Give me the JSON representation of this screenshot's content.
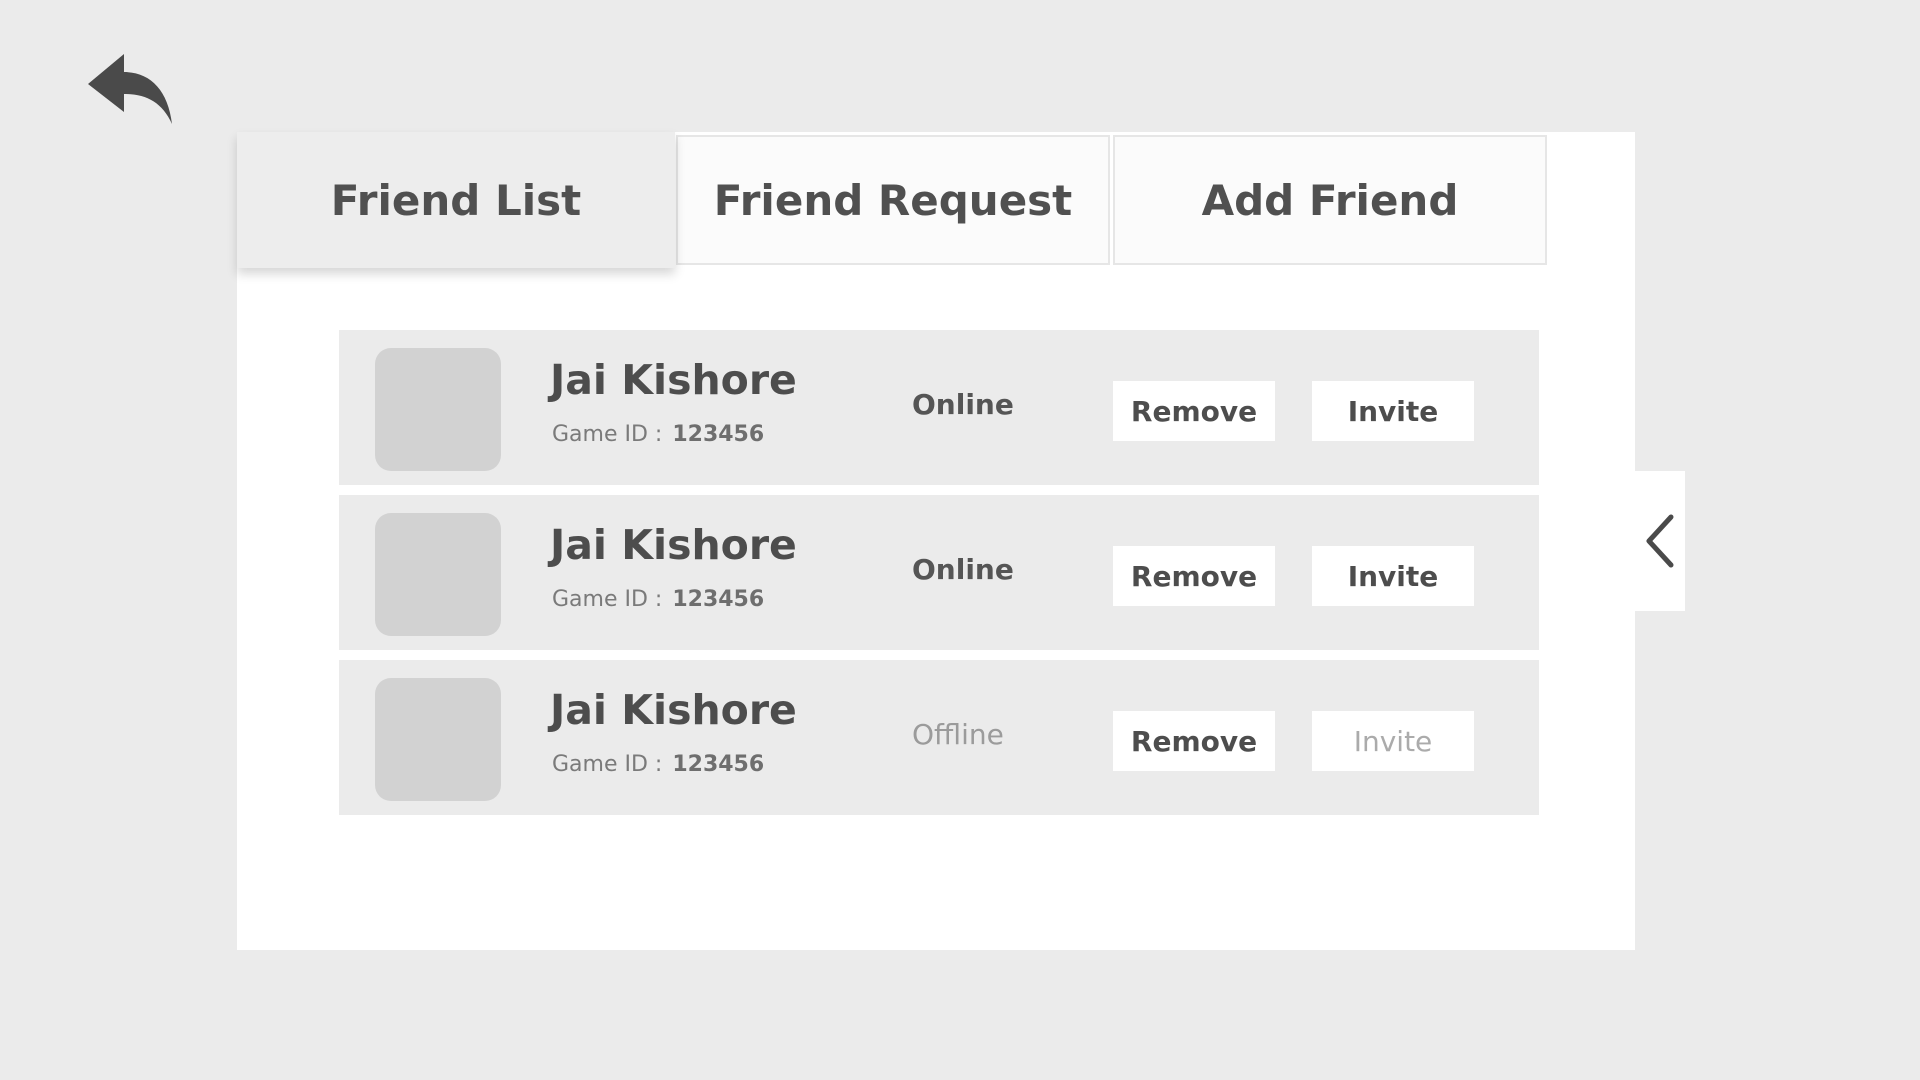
{
  "nav": {
    "back_icon": "back-arrow-icon"
  },
  "tabs": [
    {
      "label": "Friend List",
      "active": true
    },
    {
      "label": "Friend Request",
      "active": false
    },
    {
      "label": "Add Friend",
      "active": false
    }
  ],
  "friends": [
    {
      "name": "Jai Kishore",
      "game_id_label": "Game ID :",
      "game_id": "123456",
      "status": "Online",
      "remove_label": "Remove",
      "invite_label": "Invite",
      "invite_enabled": true
    },
    {
      "name": "Jai Kishore",
      "game_id_label": "Game ID :",
      "game_id": "123456",
      "status": "Online",
      "remove_label": "Remove",
      "invite_label": "Invite",
      "invite_enabled": true
    },
    {
      "name": "Jai Kishore",
      "game_id_label": "Game ID :",
      "game_id": "123456",
      "status": "Offline",
      "remove_label": "Remove",
      "invite_label": "Invite",
      "invite_enabled": false
    }
  ],
  "side_panel": {
    "toggle_icon": "chevron-left-icon"
  },
  "colors": {
    "background": "#ebebeb",
    "panel": "#ffffff",
    "row": "#ebebeb",
    "avatar": "#d2d2d2",
    "text": "#4d4d4d",
    "muted": "#9b9b9b"
  }
}
